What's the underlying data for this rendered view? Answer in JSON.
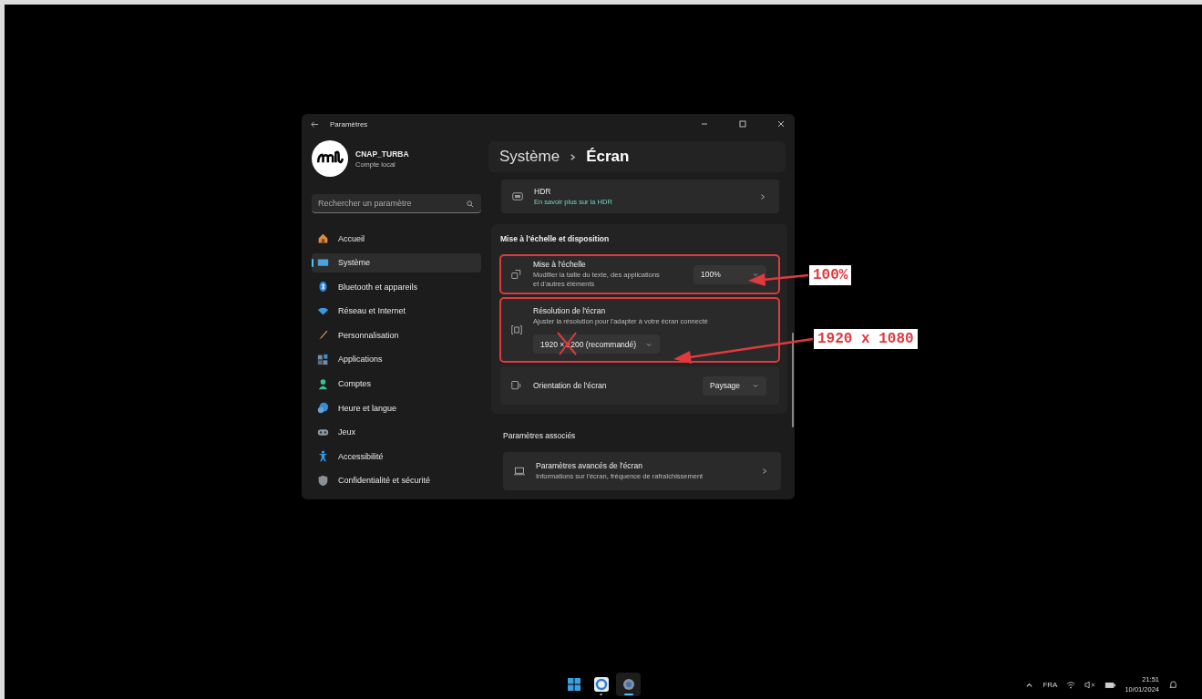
{
  "window": {
    "title": "Paramètres"
  },
  "account": {
    "name": "CNAP_TURBA",
    "type": "Compte local"
  },
  "search": {
    "placeholder": "Rechercher un paramètre"
  },
  "sidebar": {
    "items": [
      {
        "label": "Accueil",
        "selected": false
      },
      {
        "label": "Système",
        "selected": true
      },
      {
        "label": "Bluetooth et appareils",
        "selected": false
      },
      {
        "label": "Réseau et Internet",
        "selected": false
      },
      {
        "label": "Personnalisation",
        "selected": false
      },
      {
        "label": "Applications",
        "selected": false
      },
      {
        "label": "Comptes",
        "selected": false
      },
      {
        "label": "Heure et langue",
        "selected": false
      },
      {
        "label": "Jeux",
        "selected": false
      },
      {
        "label": "Accessibilité",
        "selected": false
      },
      {
        "label": "Confidentialité et sécurité",
        "selected": false
      }
    ]
  },
  "breadcrumb": [
    "Système",
    "Écran"
  ],
  "hdr_row": {
    "title": "HDR",
    "link": "En savoir plus sur la HDR"
  },
  "sections": [
    {
      "heading": "Mise à l'échelle et disposition",
      "rows": [
        {
          "kind": "dropdown",
          "title": "Mise à l'échelle",
          "description": "Modifier la taille du texte, des applications et d'autres éléments",
          "value": "100%",
          "highlighted": true,
          "crossed_out": false
        },
        {
          "kind": "dropdown-below",
          "title": "Résolution de l'écran",
          "description": "Ajuster la résolution pour l'adapter à  votre  écran connecté",
          "value": "1920 × 1200 (recommandé)",
          "highlighted": true,
          "crossed_out": true
        },
        {
          "kind": "dropdown",
          "title": "Orientation de l'écran",
          "value": "Paysage",
          "highlighted": false,
          "crossed_out": false
        }
      ]
    },
    {
      "heading": "Paramètres associés",
      "rows": [
        {
          "kind": "link",
          "title": "Paramètres avancés de l'écran",
          "description": "Informations sur l'écran, fréquence de rafraîchissement",
          "highlighted": false
        }
      ]
    }
  ],
  "annotations": [
    {
      "label": "100%"
    },
    {
      "label": "1920 x 1080"
    }
  ],
  "taskbar": {
    "apps": [
      {
        "kind": "start",
        "running": false,
        "selected": false
      },
      {
        "kind": "app",
        "running": true,
        "selected": false
      },
      {
        "kind": "settings",
        "running": true,
        "selected": true
      }
    ]
  },
  "tray": {
    "language": "FRA",
    "time": "21:51",
    "date": "10/01/2024"
  }
}
